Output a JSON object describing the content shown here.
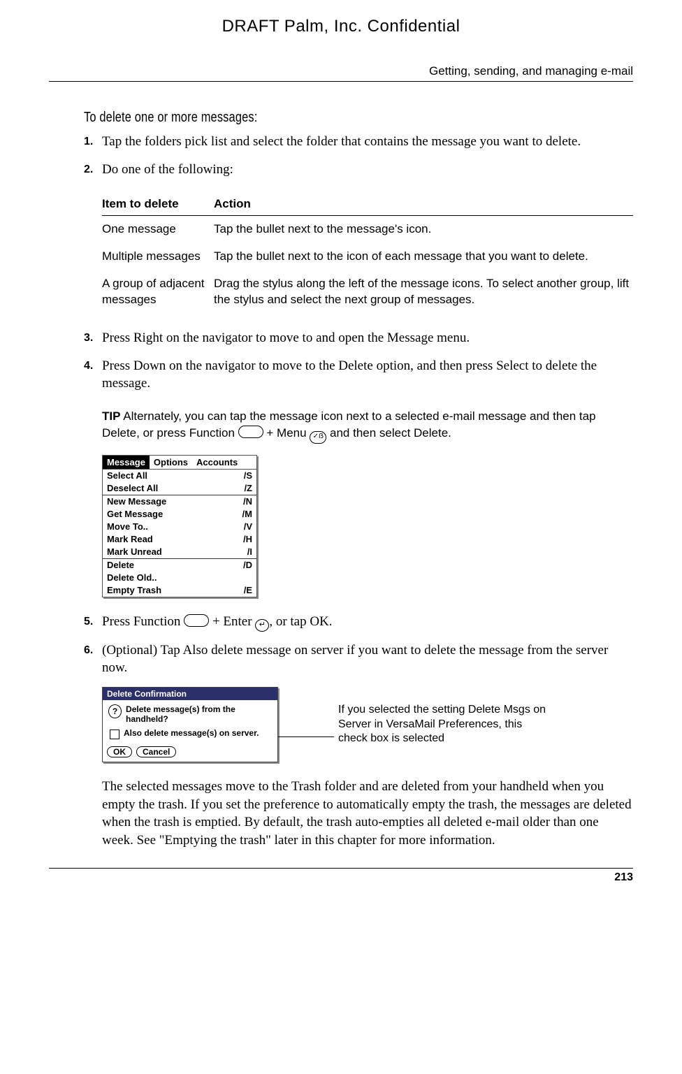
{
  "header": {
    "draft": "DRAFT   Palm, Inc. Confidential",
    "running": "Getting, sending, and managing e-mail"
  },
  "section_title": "To delete one or more messages:",
  "steps": {
    "s1": {
      "num": "1.",
      "text": "Tap the folders pick list and select the folder that contains the message you want to delete."
    },
    "s2": {
      "num": "2.",
      "text": "Do one of the following:"
    },
    "s3": {
      "num": "3.",
      "text": "Press Right on the navigator to move to and open the Message menu."
    },
    "s4": {
      "num": "4.",
      "text": "Press Down on the navigator to move to the Delete option, and then press Select to delete the message."
    },
    "s5": {
      "num": "5.",
      "pre": "Press Function ",
      "mid": " + Enter ",
      "post": ", or tap OK."
    },
    "s6": {
      "num": "6.",
      "text": "(Optional) Tap Also delete message on server if you want to delete the message from the server now."
    }
  },
  "table": {
    "h1": "Item to delete",
    "h2": "Action",
    "rows": [
      {
        "c1": "One message",
        "c2": "Tap the bullet next to the message's icon."
      },
      {
        "c1": "Multiple messages",
        "c2": "Tap the bullet next to the icon of each message that you want to delete."
      },
      {
        "c1": "A group of adjacent messages",
        "c2": "Drag the stylus along the left of the message icons. To select another group, lift the stylus and select the next group of messages."
      }
    ]
  },
  "tip": {
    "label": "TIP",
    "pre": "   Alternately, you can tap the message icon next to a selected e-mail message and then tap Delete, or press Function ",
    "mid": " + Menu ",
    "post": " and then select Delete."
  },
  "menu": {
    "tabs": {
      "a": "Message",
      "b": "Options",
      "c": "Accounts"
    },
    "items": [
      {
        "l": "Select All",
        "r": "/S"
      },
      {
        "l": "Deselect All",
        "r": "/Z"
      },
      {
        "l": "New Message",
        "r": "/N"
      },
      {
        "l": "Get Message",
        "r": "/M"
      },
      {
        "l": "Move To..",
        "r": "/V"
      },
      {
        "l": "Mark Read",
        "r": "/H"
      },
      {
        "l": "Mark Unread",
        "r": "/I"
      },
      {
        "l": "Delete",
        "r": "/D"
      },
      {
        "l": "Delete Old..",
        "r": ""
      },
      {
        "l": "Empty Trash",
        "r": "/E"
      }
    ]
  },
  "dialog": {
    "title": "Delete Confirmation",
    "line1": "Delete message(s) from the handheld?",
    "line2": "Also delete message(s) on server.",
    "ok": "OK",
    "cancel": "Cancel"
  },
  "callout": "If you selected the setting Delete Msgs on Server in VersaMail Preferences, this check box is selected",
  "para_end": "The selected messages move to the Trash folder and are deleted from your handheld when you empty the trash. If you set the preference to automatically empty the trash, the messages are deleted when the trash is emptied. By default, the trash auto-empties all deleted e-mail older than one week. See \"Emptying the trash\" later in this chapter for more information.",
  "page_num": "213"
}
